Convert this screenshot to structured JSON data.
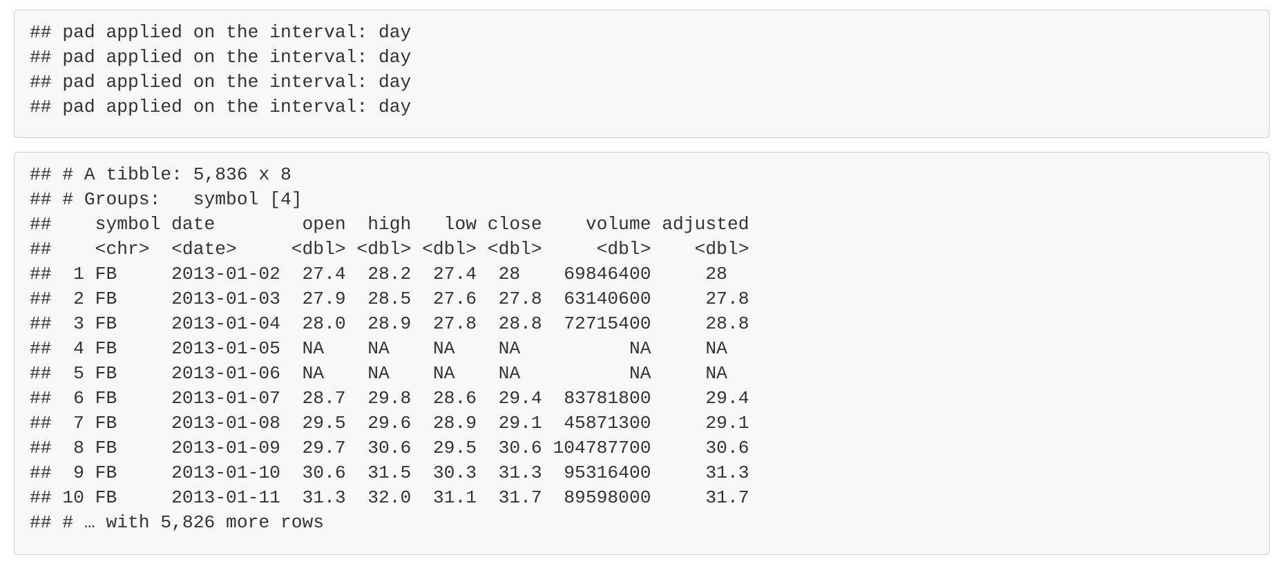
{
  "messages_block": {
    "lines": [
      "## pad applied on the interval: day",
      "## pad applied on the interval: day",
      "## pad applied on the interval: day",
      "## pad applied on the interval: day"
    ]
  },
  "tibble_block": {
    "header_lines": [
      "## # A tibble: 5,836 x 8",
      "## # Groups:   symbol [4]",
      "##    symbol date        open  high   low close    volume adjusted",
      "##    <chr>  <date>     <dbl> <dbl> <dbl> <dbl>     <dbl>    <dbl>"
    ],
    "rows": [
      "##  1 FB     2013-01-02  27.4  28.2  27.4  28    69846400     28  ",
      "##  2 FB     2013-01-03  27.9  28.5  27.6  27.8  63140600     27.8",
      "##  3 FB     2013-01-04  28.0  28.9  27.8  28.8  72715400     28.8",
      "##  4 FB     2013-01-05  NA    NA    NA    NA          NA     NA  ",
      "##  5 FB     2013-01-06  NA    NA    NA    NA          NA     NA  ",
      "##  6 FB     2013-01-07  28.7  29.8  28.6  29.4  83781800     29.4",
      "##  7 FB     2013-01-08  29.5  29.6  28.9  29.1  45871300     29.1",
      "##  8 FB     2013-01-09  29.7  30.6  29.5  30.6 104787700     30.6",
      "##  9 FB     2013-01-10  30.6  31.5  30.3  31.3  95316400     31.3",
      "## 10 FB     2013-01-11  31.3  32.0  31.1  31.7  89598000     31.7"
    ],
    "footer_line": "## # … with 5,826 more rows"
  }
}
